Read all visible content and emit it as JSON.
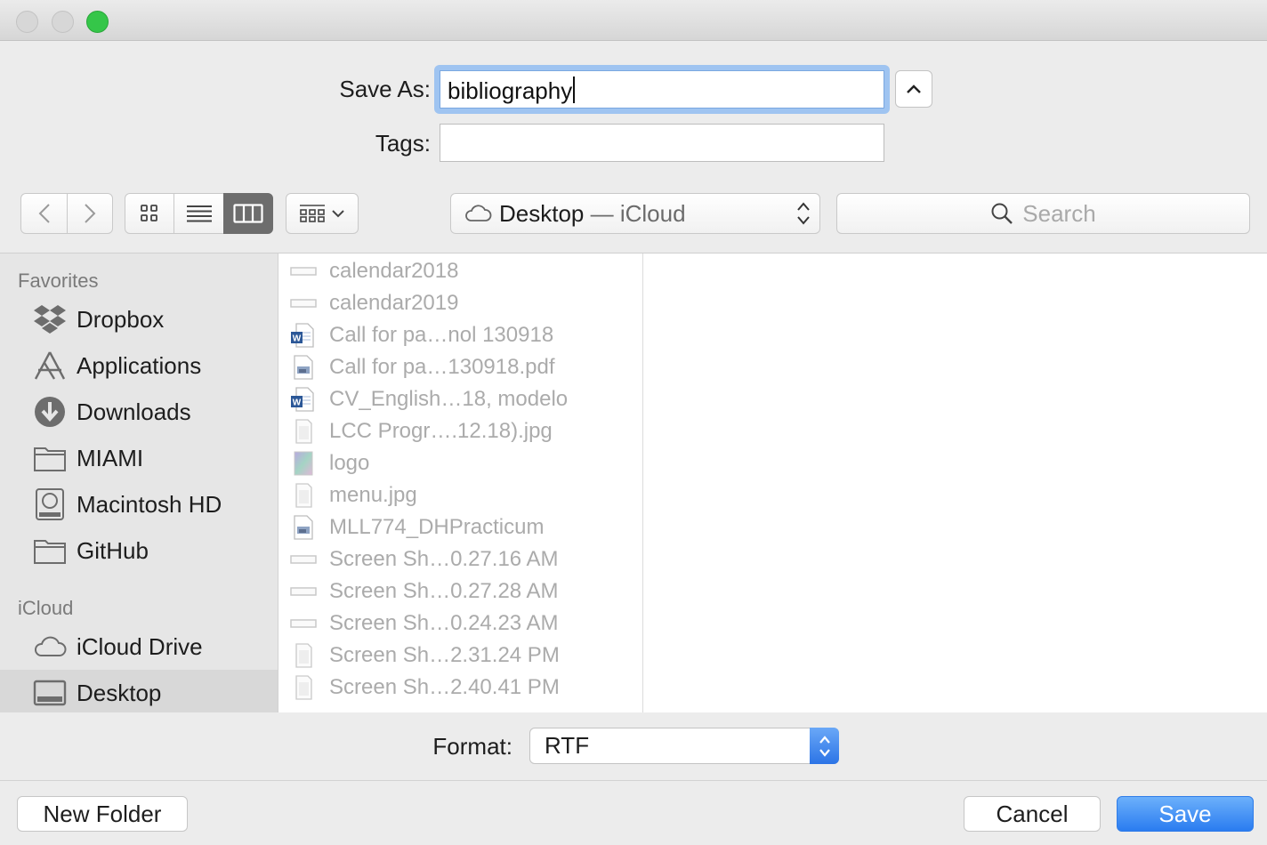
{
  "dialog": {
    "save_as_label": "Save As:",
    "save_as_value": "bibliography",
    "tags_label": "Tags:",
    "tags_value": ""
  },
  "toolbar": {
    "location_main": "Desktop",
    "location_sub": " — iCloud",
    "search_placeholder": "Search",
    "active_view": "column"
  },
  "sidebar": {
    "sections": [
      {
        "title": "Favorites",
        "items": [
          {
            "label": "Dropbox",
            "icon": "dropbox-icon"
          },
          {
            "label": "Applications",
            "icon": "applications-icon"
          },
          {
            "label": "Downloads",
            "icon": "downloads-icon"
          },
          {
            "label": "MIAMI",
            "icon": "folder-icon"
          },
          {
            "label": "Macintosh HD",
            "icon": "hard-drive-icon"
          },
          {
            "label": "GitHub",
            "icon": "folder-icon"
          }
        ]
      },
      {
        "title": "iCloud",
        "items": [
          {
            "label": "iCloud Drive",
            "icon": "icloud-icon"
          },
          {
            "label": "Desktop",
            "icon": "desktop-icon",
            "selected": true
          }
        ]
      }
    ]
  },
  "files": [
    {
      "name": "calendar2018",
      "icon": "image-wide-icon"
    },
    {
      "name": "calendar2019",
      "icon": "image-wide-icon"
    },
    {
      "name": "Call for pa…nol 130918",
      "icon": "word-doc-icon"
    },
    {
      "name": "Call for pa…130918.pdf",
      "icon": "pdf-icon"
    },
    {
      "name": "CV_English…18, modelo",
      "icon": "word-doc-icon"
    },
    {
      "name": "LCC Progr….12.18).jpg",
      "icon": "image-doc-icon"
    },
    {
      "name": "logo",
      "icon": "image-color-icon"
    },
    {
      "name": "menu.jpg",
      "icon": "image-doc-icon"
    },
    {
      "name": "MLL774_DHPracticum",
      "icon": "pdf-icon"
    },
    {
      "name": "Screen Sh…0.27.16 AM",
      "icon": "image-wide-icon"
    },
    {
      "name": "Screen Sh…0.27.28 AM",
      "icon": "image-wide-icon"
    },
    {
      "name": "Screen Sh…0.24.23 AM",
      "icon": "image-wide-icon"
    },
    {
      "name": "Screen Sh…2.31.24 PM",
      "icon": "image-doc-icon"
    },
    {
      "name": "Screen Sh…2.40.41 PM",
      "icon": "image-doc-icon"
    }
  ],
  "format": {
    "label": "Format:",
    "value": "RTF"
  },
  "buttons": {
    "new_folder": "New Folder",
    "cancel": "Cancel",
    "save": "Save"
  },
  "colors": {
    "accent": "#2a7cf0",
    "maximize": "#35c649",
    "dim_text": "#ababab"
  }
}
